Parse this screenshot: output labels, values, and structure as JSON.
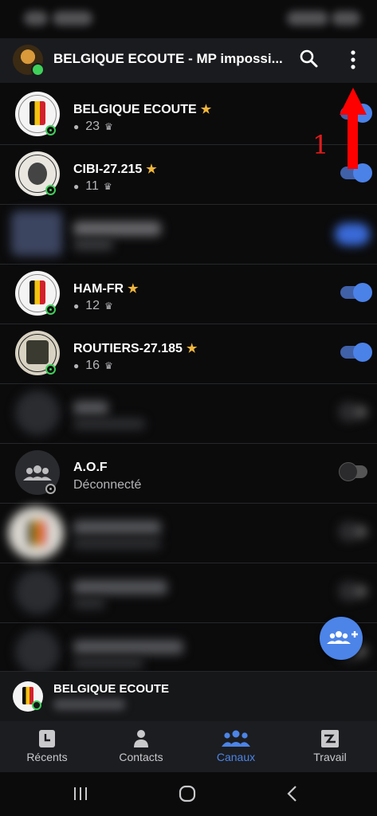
{
  "header": {
    "title": "BELGIQUE ECOUTE - MP impossi..."
  },
  "channels": [
    {
      "name": "BELGIQUE ECOUTE",
      "count": "23",
      "starred": true,
      "enabled": true,
      "blurred": false
    },
    {
      "name": "CIBI-27.215",
      "count": "11",
      "starred": true,
      "enabled": true,
      "blurred": false
    },
    {
      "name": "",
      "count": "",
      "starred": false,
      "enabled": true,
      "blurred": true
    },
    {
      "name": "HAM-FR",
      "count": "12",
      "starred": true,
      "enabled": true,
      "blurred": false
    },
    {
      "name": "ROUTIERS-27.185",
      "count": "16",
      "starred": true,
      "enabled": true,
      "blurred": false
    },
    {
      "name": "",
      "count": "",
      "starred": false,
      "enabled": false,
      "blurred": true
    },
    {
      "name": "A.O.F",
      "status": "Déconnecté",
      "starred": false,
      "enabled": false,
      "blurred": false
    },
    {
      "name": "",
      "count": "",
      "starred": false,
      "enabled": false,
      "blurred": true
    },
    {
      "name": "",
      "count": "",
      "starred": false,
      "enabled": false,
      "blurred": true
    },
    {
      "name": "",
      "count": "",
      "starred": false,
      "enabled": false,
      "blurred": true
    }
  ],
  "annotation": {
    "number": "1"
  },
  "now_playing": {
    "title": "BELGIQUE ECOUTE"
  },
  "tabs": [
    {
      "label": "Récents",
      "icon": "recents-icon",
      "active": false
    },
    {
      "label": "Contacts",
      "icon": "contact-icon",
      "active": false
    },
    {
      "label": "Canaux",
      "icon": "channels-icon",
      "active": true
    },
    {
      "label": "Travail",
      "icon": "work-icon",
      "active": false
    }
  ],
  "colors": {
    "accent": "#4c84e8",
    "online": "#3fd05a",
    "star": "#f0b63c",
    "annotation": "#ff0000"
  }
}
